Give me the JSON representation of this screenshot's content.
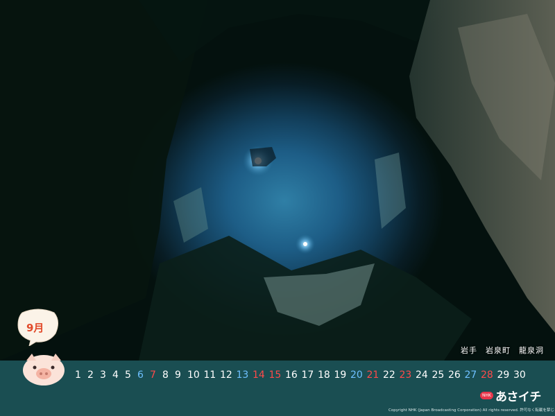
{
  "photo": {
    "subject": "underwater cave photograph"
  },
  "location": "岩手　岩泉町　龍泉洞",
  "calendar": {
    "month_label": "9月",
    "days": [
      {
        "n": "1",
        "c": "w"
      },
      {
        "n": "2",
        "c": "w"
      },
      {
        "n": "3",
        "c": "w"
      },
      {
        "n": "4",
        "c": "w"
      },
      {
        "n": "5",
        "c": "w"
      },
      {
        "n": "6",
        "c": "b"
      },
      {
        "n": "7",
        "c": "r"
      },
      {
        "n": "8",
        "c": "w"
      },
      {
        "n": "9",
        "c": "w"
      },
      {
        "n": "10",
        "c": "w"
      },
      {
        "n": "11",
        "c": "w"
      },
      {
        "n": "12",
        "c": "w"
      },
      {
        "n": "13",
        "c": "b"
      },
      {
        "n": "14",
        "c": "r"
      },
      {
        "n": "15",
        "c": "r"
      },
      {
        "n": "16",
        "c": "w"
      },
      {
        "n": "17",
        "c": "w"
      },
      {
        "n": "18",
        "c": "w"
      },
      {
        "n": "19",
        "c": "w"
      },
      {
        "n": "20",
        "c": "b"
      },
      {
        "n": "21",
        "c": "r"
      },
      {
        "n": "22",
        "c": "w"
      },
      {
        "n": "23",
        "c": "r"
      },
      {
        "n": "24",
        "c": "w"
      },
      {
        "n": "25",
        "c": "w"
      },
      {
        "n": "26",
        "c": "w"
      },
      {
        "n": "27",
        "c": "b"
      },
      {
        "n": "28",
        "c": "r"
      },
      {
        "n": "29",
        "c": "w"
      },
      {
        "n": "30",
        "c": "w"
      }
    ]
  },
  "logo": {
    "badge": "NHK",
    "text": "あさイチ"
  },
  "copyright": "Copyright NHK (Japan Broadcasting Corporation) All rights reserved.  許可なく転載を禁じます",
  "colors": {
    "footer": "#1a4e52",
    "saturday": "#6ec0ff",
    "holiday": "#ff4a4a",
    "month": "#e24a2a"
  }
}
